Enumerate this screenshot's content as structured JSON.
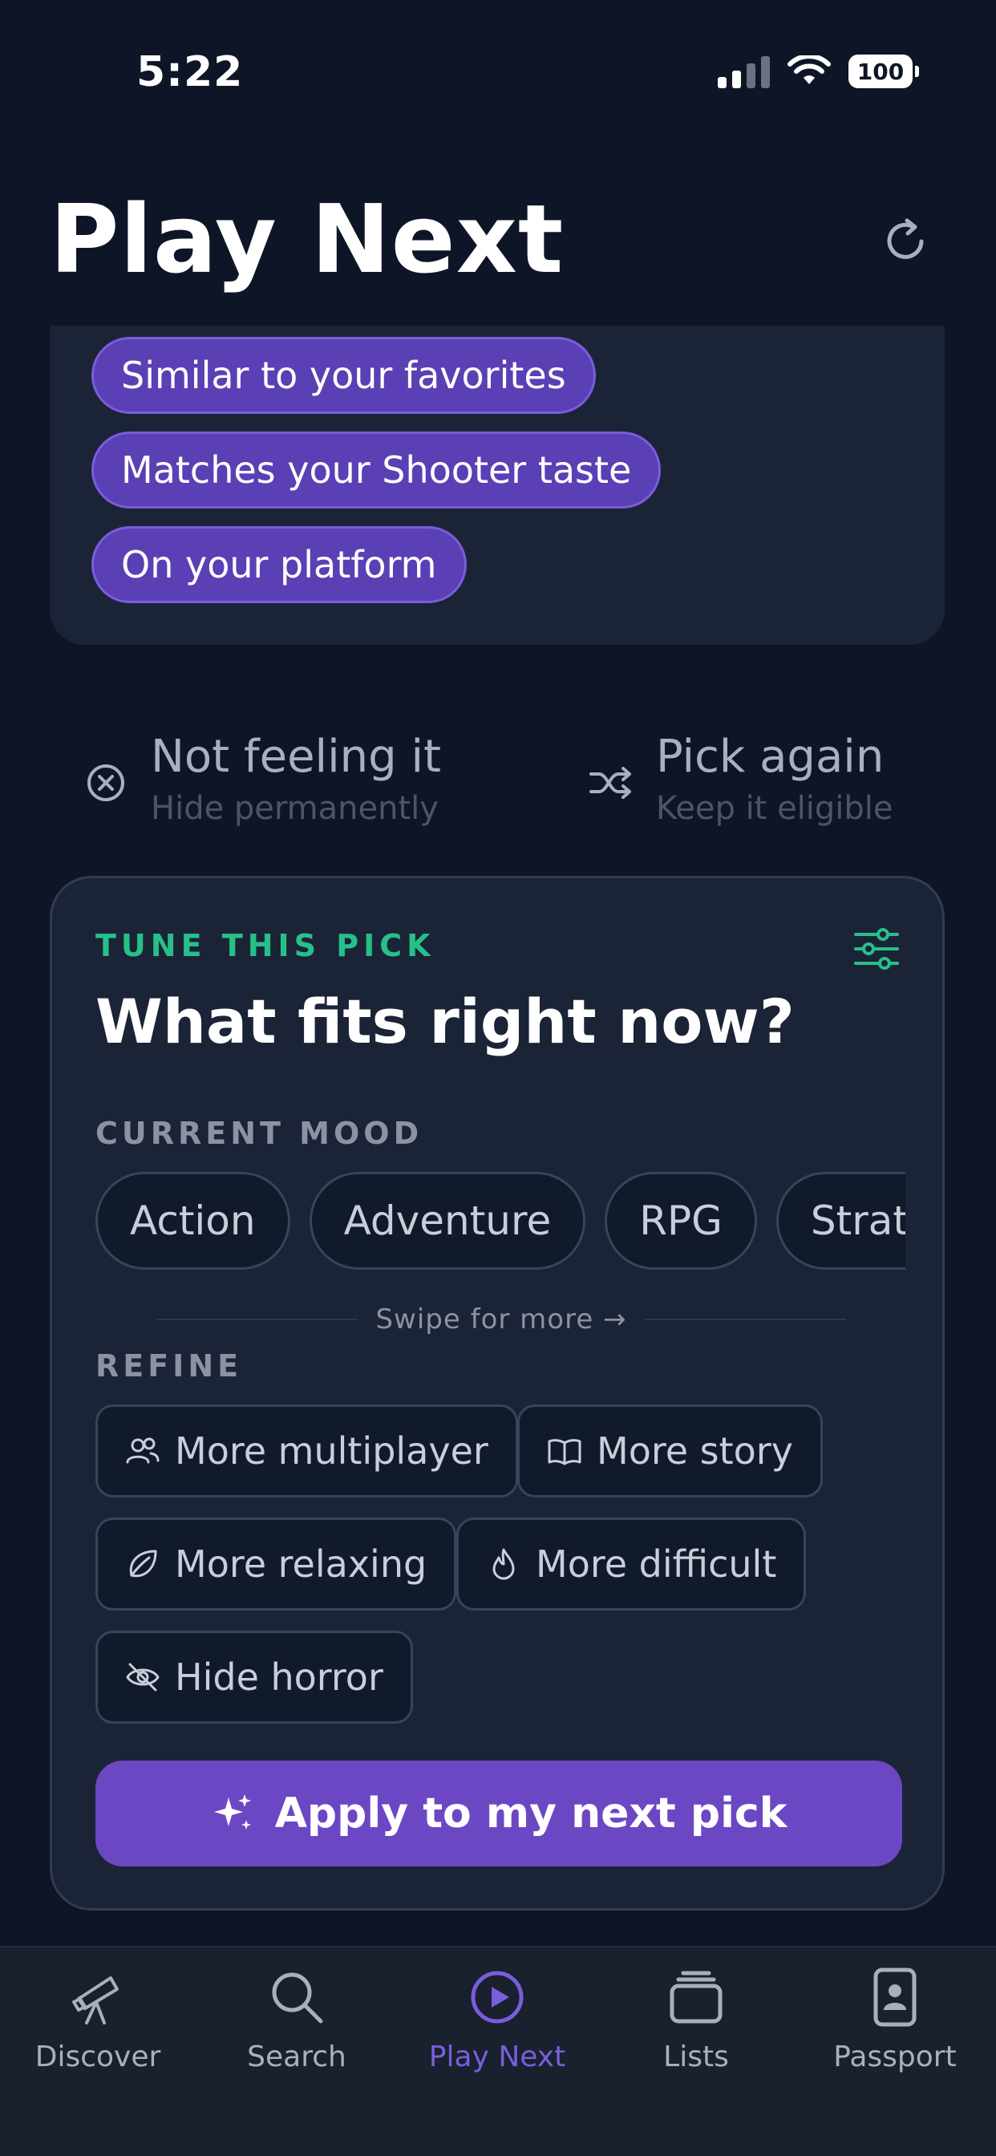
{
  "status_bar": {
    "time": "5:22",
    "battery": "100"
  },
  "header": {
    "title": "Play Next"
  },
  "reasons": [
    "Similar to your favorites",
    "Matches your Shooter taste",
    "On your platform"
  ],
  "actions": {
    "not_feeling": {
      "title": "Not feeling it",
      "subtitle": "Hide permanently"
    },
    "pick_again": {
      "title": "Pick again",
      "subtitle": "Keep it eligible"
    }
  },
  "tune": {
    "label": "TUNE THIS PICK",
    "heading": "What fits right now?",
    "mood_label": "CURRENT MOOD",
    "moods": [
      "Action",
      "Adventure",
      "RPG",
      "Strategy"
    ],
    "swipe_hint": "Swipe for more",
    "refine_label": "REFINE",
    "refine": {
      "multiplayer": "More multiplayer",
      "story": "More story",
      "relaxing": "More relaxing",
      "difficult": "More difficult",
      "horror": "Hide horror"
    },
    "apply": "Apply to my next pick"
  },
  "tabs": {
    "discover": "Discover",
    "search": "Search",
    "play_next": "Play Next",
    "lists": "Lists",
    "passport": "Passport"
  },
  "colors": {
    "accent": "#6c47c4",
    "highlight": "#27c08a",
    "background": "#0e1526",
    "card": "#1b2436"
  }
}
